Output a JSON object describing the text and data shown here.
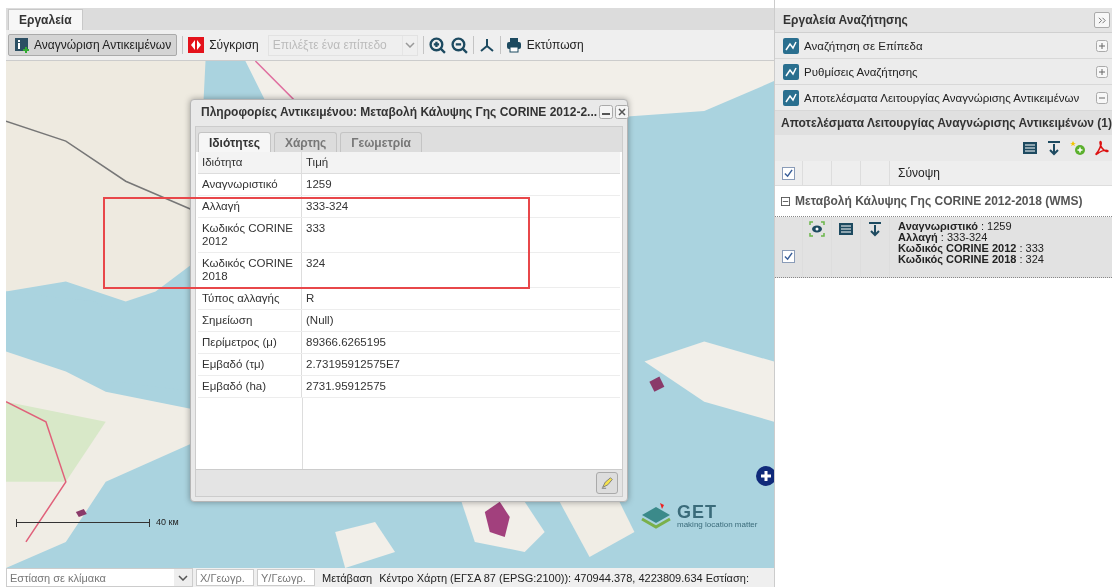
{
  "left_tabs": [
    {
      "label": "Εργαλεία",
      "selected": true
    }
  ],
  "toolbar": {
    "identify_button": {
      "label": "Αναγνώριση Αντικειμένων",
      "pressed": true
    },
    "compare_label": "Σύγκριση",
    "layer_select": {
      "placeholder": "Επιλέξτε ένα επίπεδο",
      "disabled": true
    },
    "print_label": "Εκτύπωση"
  },
  "map": {
    "scale_label": "40 км",
    "logo": {
      "name": "GET",
      "slogan": "making location matter"
    }
  },
  "annotation_box": true,
  "popup": {
    "title": "Πληροφορίες Αντικειμένου: Μεταβολή Κάλυψης Γης CORINE 2012-2...",
    "tabs": [
      {
        "label": "Ιδιότητες",
        "selected": true
      },
      {
        "label": "Χάρτης",
        "selected": false
      },
      {
        "label": "Γεωμετρία",
        "selected": false
      }
    ],
    "columns": [
      "Ιδιότητα",
      "Τιμή"
    ],
    "rows": [
      {
        "property": "Αναγνωριστικό",
        "value": "1259"
      },
      {
        "property": "Αλλαγή",
        "value": "333-324"
      },
      {
        "property": "Κωδικός CORINE 2012",
        "value": "333"
      },
      {
        "property": "Κωδικός CORINE 2018",
        "value": "324"
      },
      {
        "property": "Τύπος αλλαγής",
        "value": "R"
      },
      {
        "property": "Σημείωση",
        "value": "(Null)"
      },
      {
        "property": "Περίμετρος (μ)",
        "value": "89366.6265195"
      },
      {
        "property": "Εμβαδό (τμ)",
        "value": "2.73195912575E7"
      },
      {
        "property": "Εμβαδό (ha)",
        "value": "2731.95912575"
      }
    ]
  },
  "status_bar": {
    "scale_field": {
      "placeholder": "Εστίαση σε κλίμακα"
    },
    "x_field": {
      "placeholder": "X/Γεωγρ."
    },
    "y_field": {
      "placeholder": "Y/Γεωγρ."
    },
    "go_button": "Μετάβαση",
    "center_text": "Κέντρο Χάρτη (ΕΓΣΑ 87 (EPSG:2100)): 470944.378, 4223809.634 Εστίαση:"
  },
  "search_panel": {
    "title": "Εργαλεία Αναζήτησης",
    "sections": [
      {
        "label": "Αναζήτηση σε Επίπεδα",
        "expanded": false
      },
      {
        "label": "Ρυθμίσεις Αναζήτησης",
        "expanded": false
      },
      {
        "label": "Αποτελέσματα Λειτουργίας Αναγνώρισης Αντικειμένων",
        "expanded": true
      }
    ],
    "results_title": "Αποτελέσματα Λειτουργίας Αναγνώρισης Αντικειμένων (1)",
    "grid": {
      "column": "Σύνοψη",
      "all_checked": true,
      "group": "Μεταβολή Κάλυψης Γης CORINE 2012-2018 (WMS)",
      "group_expanded": true,
      "records": [
        {
          "checked": true,
          "fields": [
            {
              "name": "Αναγνωριστικό",
              "value": " : 1259"
            },
            {
              "name": "Αλλαγή",
              "value": " : 333-324"
            },
            {
              "name": "Κωδικός CORINE 2012",
              "value": " : 333"
            },
            {
              "name": "Κωδικός CORINE 2018",
              "value": " : 324"
            }
          ]
        }
      ]
    }
  }
}
